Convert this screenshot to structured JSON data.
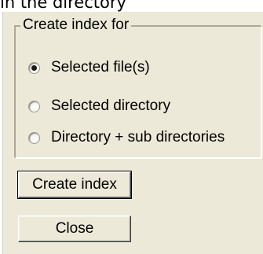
{
  "page": {
    "heading": "in the directory"
  },
  "dialog": {
    "group_title": "Create index for",
    "options": [
      {
        "label": "Selected file(s)",
        "checked": true
      },
      {
        "label": "Selected directory",
        "checked": false
      },
      {
        "label": "Directory + sub directories",
        "checked": false
      }
    ],
    "buttons": {
      "create_index": "Create index",
      "close": "Close"
    }
  },
  "colors": {
    "dialog_background": "#ece9d8",
    "page_background": "#ffffff"
  }
}
